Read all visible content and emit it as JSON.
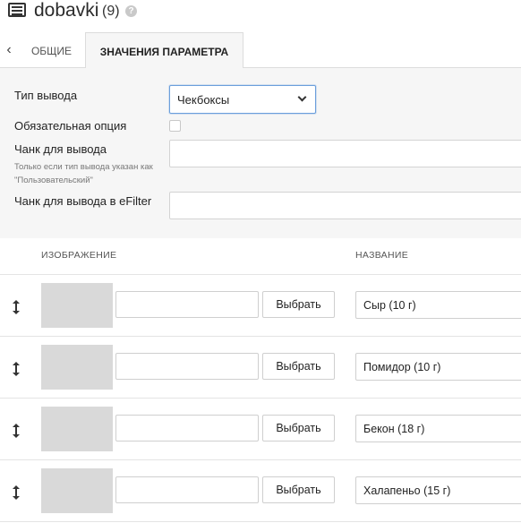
{
  "header": {
    "title": "dobavki",
    "count": "(9)",
    "help": "?"
  },
  "tabs": {
    "back": "‹",
    "general": "ОБЩИЕ",
    "values": "ЗНАЧЕНИЯ ПАРАМЕТРА"
  },
  "settings": {
    "output_type_label": "Тип вывода",
    "output_type_value": "Чекбоксы",
    "required_label": "Обязательная опция",
    "required_checked": false,
    "chunk_label": "Чанк для вывода",
    "chunk_hint": "Только если тип вывода указан как \"Пользовательский\"",
    "chunk_value": "",
    "efilter_label": "Чанк для вывода в eFilter",
    "efilter_value": ""
  },
  "table": {
    "columns": [
      "ИЗОБРАЖЕНИЕ",
      "НАЗВАНИЕ"
    ],
    "choose_label": "Выбрать",
    "rows": [
      {
        "image_path": "",
        "name": "Сыр (10 г)"
      },
      {
        "image_path": "",
        "name": "Помидор (10 г)"
      },
      {
        "image_path": "",
        "name": "Бекон (18 г)"
      },
      {
        "image_path": "",
        "name": "Халапеньо (15 г)"
      }
    ]
  },
  "icons": {
    "title_icon": "list-icon",
    "drag_handle": "drag-vertical-icon",
    "dropdown": "chevron-down-icon"
  },
  "colors": {
    "panel_bg": "#f6f6f6",
    "focus_border": "#6b9fdc",
    "thumb_placeholder": "#d9d9d9"
  }
}
